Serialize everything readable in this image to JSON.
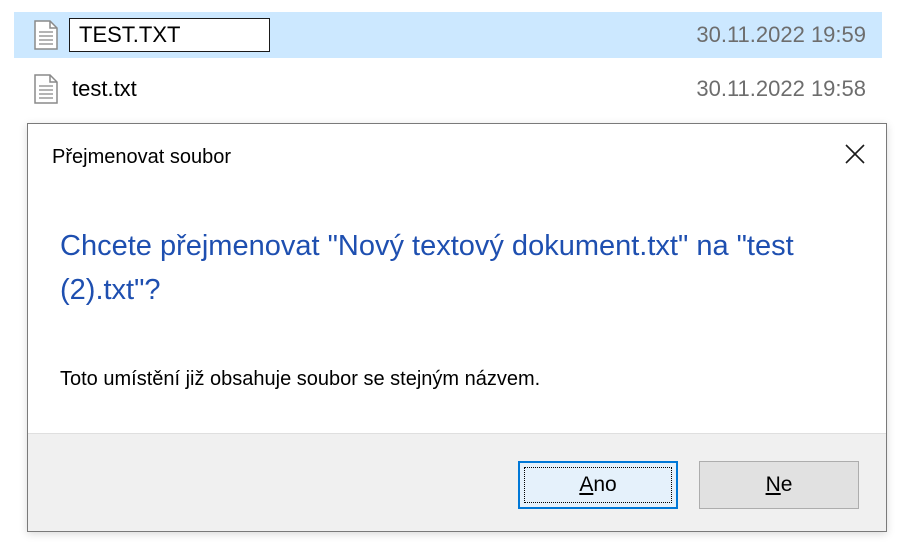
{
  "files": [
    {
      "name": "TEST.TXT",
      "date": "30.11.2022 19:59",
      "selected": true,
      "editing": true,
      "icon": "text-file-icon"
    },
    {
      "name": "test.txt",
      "date": "30.11.2022 19:58",
      "selected": false,
      "editing": false,
      "icon": "text-file-icon"
    }
  ],
  "dialog": {
    "title": "Přejmenovat soubor",
    "close_icon": "close-icon",
    "instruction": "Chcete přejmenovat \"Nový textový dokument.txt\" na \"test (2).txt\"?",
    "content": "Toto umístění již obsahuje soubor se stejným názvem.",
    "buttons": {
      "yes": {
        "accel": "A",
        "rest": "no"
      },
      "no": {
        "accel": "N",
        "rest": "e"
      }
    }
  },
  "colors": {
    "selection": "#cce8ff",
    "instruction_text": "#1e4fb0",
    "date_text": "#6d6d6d",
    "default_button_border": "#0078d7"
  }
}
